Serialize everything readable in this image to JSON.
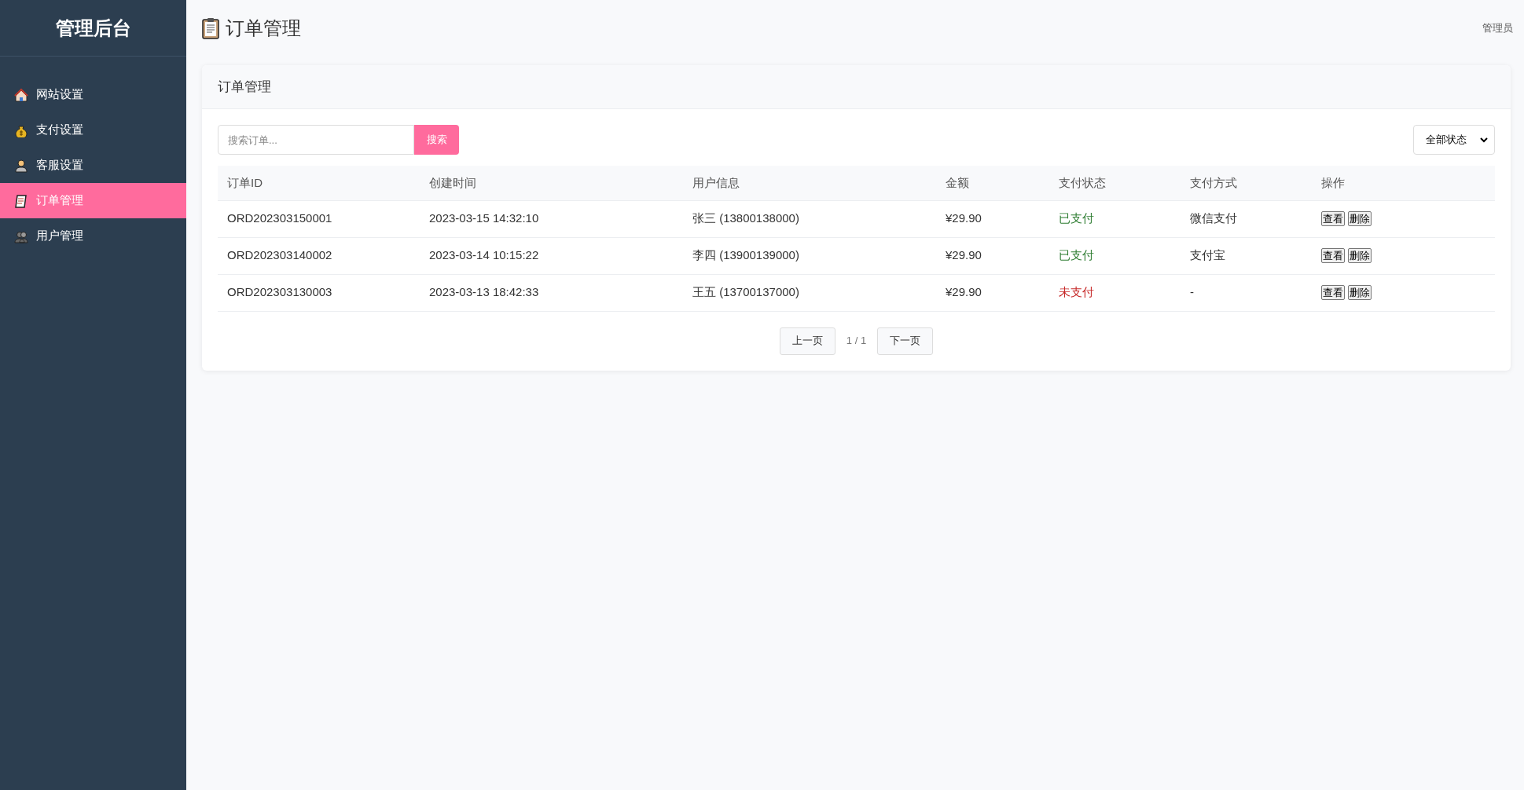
{
  "sidebar": {
    "title": "管理后台",
    "items": [
      {
        "label": "网站设置",
        "selected": false
      },
      {
        "label": "支付设置",
        "selected": false
      },
      {
        "label": "客服设置",
        "selected": false
      },
      {
        "label": "订单管理",
        "selected": true
      },
      {
        "label": "用户管理",
        "selected": false
      }
    ]
  },
  "header": {
    "title": "订单管理",
    "user": "管理员"
  },
  "card": {
    "title": "订单管理",
    "search": {
      "placeholder": "搜索订单...",
      "button": "搜索"
    },
    "status_filter": {
      "value": "全部状态"
    },
    "table": {
      "columns": [
        "订单ID",
        "创建时间",
        "用户信息",
        "金额",
        "支付状态",
        "支付方式",
        "操作"
      ],
      "rows": [
        {
          "id": "ORD202303150001",
          "created": "2023-03-15 14:32:10",
          "user": "张三 (13800138000)",
          "amount": "¥29.90",
          "status": {
            "text": "已支付",
            "kind": "paid"
          },
          "method": "微信支付",
          "actions": [
            "查看",
            "删除"
          ]
        },
        {
          "id": "ORD202303140002",
          "created": "2023-03-14 10:15:22",
          "user": "李四 (13900139000)",
          "amount": "¥29.90",
          "status": {
            "text": "已支付",
            "kind": "paid"
          },
          "method": "支付宝",
          "actions": [
            "查看",
            "删除"
          ]
        },
        {
          "id": "ORD202303130003",
          "created": "2023-03-13 18:42:33",
          "user": "王五 (13700137000)",
          "amount": "¥29.90",
          "status": {
            "text": "未支付",
            "kind": "unpaid"
          },
          "method": "-",
          "actions": [
            "查看",
            "删除"
          ]
        }
      ]
    },
    "pagination": {
      "prev": "上一页",
      "page": "1 / 1",
      "next": "下一页"
    }
  }
}
